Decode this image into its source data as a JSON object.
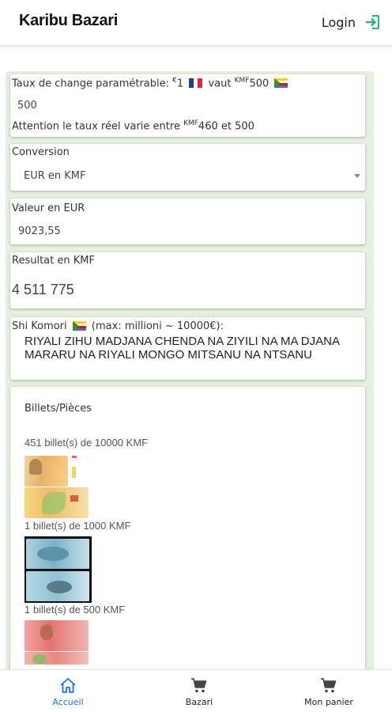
{
  "header": {
    "brand": "Karibu Bazari",
    "login_label": "Login",
    "login_icon": "login-arrow-icon"
  },
  "rate_card": {
    "label_prefix": "Taux de change paramétrable: ",
    "euro_symbol": "€",
    "amount": "1",
    "label_vaut": " vaut ",
    "kmf_sup": "KMF",
    "rate": "500",
    "value": "500",
    "warning_prefix": "Attention le taux réel varie entre ",
    "warning_sup": "KMF",
    "warning_range": "460 et 500"
  },
  "conversion": {
    "label": "Conversion",
    "selected": "EUR en KMF"
  },
  "value_eur": {
    "label": "Valeur en EUR",
    "value": "9023,55"
  },
  "result_kmf": {
    "label": "Resultat en KMF",
    "value": "4 511 775"
  },
  "shikomori": {
    "label_prefix": "Shi Komori",
    "label_suffix": " (max: millioni ~ 10000€):",
    "text": "RIYALI ZIHU MADJANA CHENDA NA ZIYILI NA MA DJANA MARARU NA RIYALI MONGO MITSANU NA NTSANU"
  },
  "notes": {
    "title": "Billets/Pièces",
    "items": [
      {
        "text": "451 billet(s) de 10000 KMF"
      },
      {
        "text": "1 billet(s) de 1000 KMF"
      },
      {
        "text": "1 billet(s) de 500 KMF"
      }
    ]
  },
  "bottom_nav": {
    "items": [
      {
        "label": "Accueil",
        "icon": "home-icon"
      },
      {
        "label": "Bazari",
        "icon": "cart-icon"
      },
      {
        "label": "Mon panier",
        "icon": "cart-icon"
      }
    ]
  },
  "colors": {
    "accent": "#1a73e8",
    "login_icon": "#2bb673",
    "panel_bg": "#e6efe0"
  }
}
